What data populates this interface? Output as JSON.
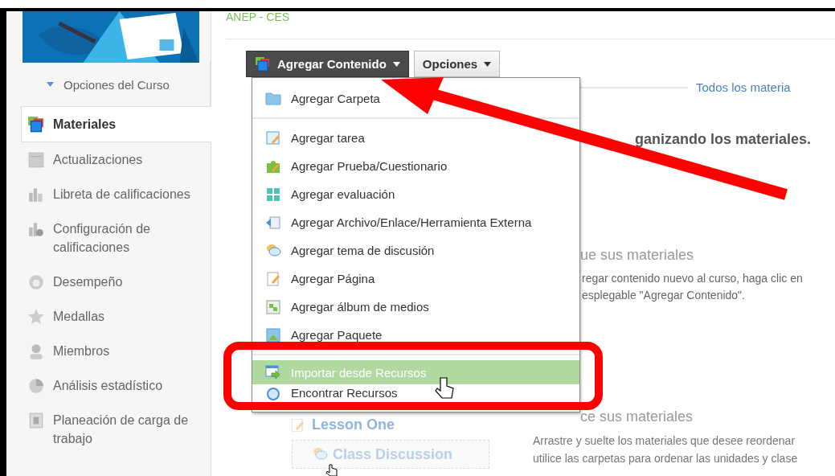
{
  "header": {
    "org": "ANEP - CES"
  },
  "sidebar": {
    "options": "Opciones del Curso",
    "items": [
      {
        "label": "Materiales",
        "selected": true
      },
      {
        "label": "Actualizaciones",
        "selected": false
      },
      {
        "label": "Libreta de calificaciones",
        "selected": false
      },
      {
        "label": "Configuración de calificaciones",
        "selected": false
      },
      {
        "label": "Desempeño",
        "selected": false
      },
      {
        "label": "Medallas",
        "selected": false
      },
      {
        "label": "Miembros",
        "selected": false
      },
      {
        "label": "Análisis estadístico",
        "selected": false
      },
      {
        "label": "Planeación de carga de trabajo",
        "selected": false
      }
    ]
  },
  "toolbar": {
    "buttons": [
      {
        "label": "Agregar Contenido",
        "expanded": true
      },
      {
        "label": "Opciones",
        "expanded": false
      }
    ]
  },
  "menu": {
    "groups": [
      [
        {
          "label": "Agregar Carpeta",
          "selected": false
        }
      ],
      [
        {
          "label": "Agregar tarea",
          "selected": false
        },
        {
          "label": "Agregar Prueba/Cuestionario",
          "selected": false
        },
        {
          "label": "Agregar evaluación",
          "selected": false
        },
        {
          "label": "Agregar Archivo/Enlace/Herramienta Externa",
          "selected": false
        },
        {
          "label": "Agregar tema de discusión",
          "selected": false
        },
        {
          "label": "Agregar Página",
          "selected": false
        },
        {
          "label": "Agregar álbum de medios",
          "selected": false
        },
        {
          "label": "Agregar Paquete",
          "selected": false
        }
      ],
      [
        {
          "label": "Importar desde Recursos",
          "selected": true
        },
        {
          "label": "Encontrar Recursos",
          "selected": false
        }
      ]
    ]
  },
  "content": {
    "filter_link": "Todos los materia",
    "intro_heading": "ganizando los materiales.",
    "add_heading": "ue sus materiales",
    "add_text": [
      "regar contenido nuevo al curso, haga clic en",
      "esplegable \"Agregar Contenido\"."
    ],
    "organize_heading": "ce sus materiales",
    "organize_text": [
      "Arrastre y suelte los materiales que desee reordenar",
      "utilice las carpetas para ordenar las unidades y clase"
    ],
    "materials": [
      {
        "title": "Lesson One",
        "kind": "page"
      },
      {
        "title": "Class Discussion",
        "kind": "discussion"
      }
    ]
  }
}
